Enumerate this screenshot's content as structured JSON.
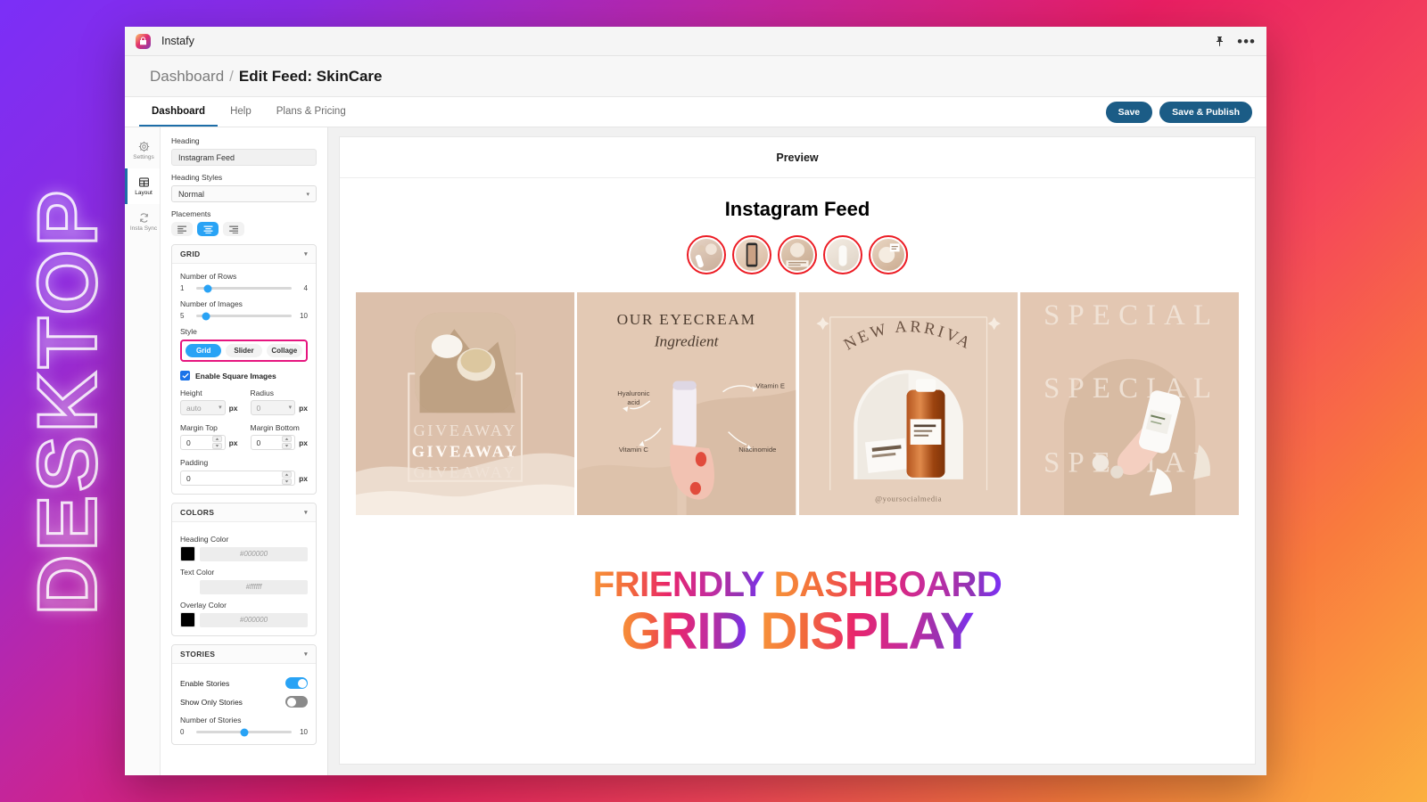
{
  "decor": {
    "side_label": "DESKTOP"
  },
  "titlebar": {
    "app_name": "Instafy",
    "logo_icon": "instafy-logo-icon",
    "pin_icon": "pin-icon",
    "more_icon": "more-options-icon",
    "more_glyph": "•••"
  },
  "breadcrumb": {
    "root": "Dashboard",
    "separator": "/",
    "current": "Edit Feed: SkinCare"
  },
  "tabs": [
    {
      "label": "Dashboard",
      "active": true
    },
    {
      "label": "Help",
      "active": false
    },
    {
      "label": "Plans & Pricing",
      "active": false
    }
  ],
  "actions": {
    "save": "Save",
    "save_publish": "Save & Publish"
  },
  "rail": [
    {
      "label": "Settings",
      "icon": "gear-icon",
      "active": false
    },
    {
      "label": "Layout",
      "icon": "layout-icon",
      "active": true
    },
    {
      "label": "Insta Sync",
      "icon": "sync-icon",
      "active": false
    }
  ],
  "panel": {
    "heading_label": "Heading",
    "heading_value": "Instagram Feed",
    "heading_styles_label": "Heading Styles",
    "heading_styles_value": "Normal",
    "placements_label": "Placements",
    "placements": [
      {
        "name": "align-left-icon",
        "active": false
      },
      {
        "name": "align-center-icon",
        "active": true
      },
      {
        "name": "align-right-icon",
        "active": false
      }
    ],
    "grid_section": {
      "title": "GRID",
      "rows_label": "Number of Rows",
      "rows_min": "1",
      "rows_max": "4",
      "rows_pct": 12,
      "images_label": "Number of Images",
      "images_min": "5",
      "images_max": "10",
      "images_pct": 10,
      "style_label": "Style",
      "styles": [
        {
          "label": "Grid",
          "active": true
        },
        {
          "label": "Slider",
          "active": false
        },
        {
          "label": "Collage",
          "active": false
        }
      ],
      "square_label": "Enable Square Images",
      "square_checked": true,
      "height_label": "Height",
      "height_value": "auto",
      "height_unit": "px",
      "radius_label": "Radius",
      "radius_value": "0",
      "radius_unit": "px",
      "margin_top_label": "Margin Top",
      "margin_top_value": "0",
      "margin_top_unit": "px",
      "margin_bottom_label": "Margin Bottom",
      "margin_bottom_value": "0",
      "margin_bottom_unit": "px",
      "padding_label": "Padding",
      "padding_value": "0",
      "padding_unit": "px"
    },
    "colors_section": {
      "title": "COLORS",
      "heading_color_label": "Heading Color",
      "heading_color_hex": "#000000",
      "text_color_label": "Text Color",
      "text_color_hex": "#ffffff",
      "overlay_color_label": "Overlay Color",
      "overlay_color_hex": "#000000"
    },
    "stories_section": {
      "title": "STORIES",
      "enable_label": "Enable Stories",
      "enable_on": true,
      "only_label": "Show Only Stories",
      "only_on": false,
      "count_label": "Number of Stories",
      "count_min": "0",
      "count_max": "10",
      "count_pct": 50
    }
  },
  "preview": {
    "header": "Preview",
    "feed_title": "Instagram Feed",
    "stories_count": 5,
    "posts": [
      {
        "name": "giveaway-post",
        "caption": "GIVEAWAY"
      },
      {
        "name": "eyecream-post",
        "title": "OUR EYECREAM",
        "subtitle": "Ingredient",
        "labels": [
          "Hyaluronic acid",
          "Vitamin E",
          "Vitamin C",
          "Niacinomide"
        ]
      },
      {
        "name": "new-arrival-post",
        "title": "NEW ARRIVAL",
        "handle": "@yoursocialmedia"
      },
      {
        "name": "special-post",
        "title": "SPECIAL"
      }
    ],
    "headline_line1": [
      {
        "text": "FRIENDLY"
      },
      {
        "text": "DASHBOARD"
      }
    ],
    "headline_line2": [
      {
        "text": "GRID"
      },
      {
        "text": "DISPLAY"
      }
    ]
  },
  "colors": {
    "accent_blue": "#29a3f5",
    "button_navy": "#1b5c86",
    "style_outline_pink": "#e6157f",
    "story_ring_red": "#ec1c24"
  }
}
